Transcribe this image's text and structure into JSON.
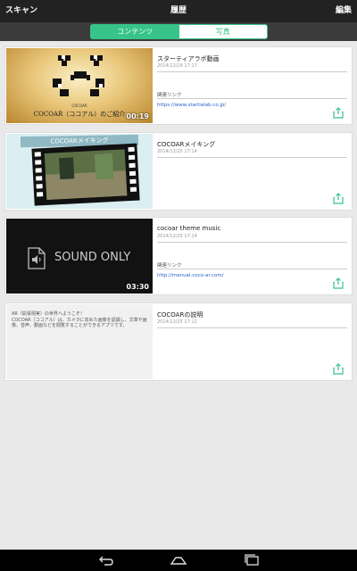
{
  "header": {
    "left_button": "スキャン",
    "title": "履歴",
    "right_button": "編集"
  },
  "tabs": [
    {
      "label": "コンテンツ",
      "active": true
    },
    {
      "label": "写真",
      "active": false
    }
  ],
  "cards": [
    {
      "title": "スターティアラボ動画",
      "date": "2014/12/29 17:17",
      "related_label": "関連リンク",
      "related_link": "https://www.startialab.co.jp/",
      "thumb_caption": "COCOAR（ココアル）のご紹介",
      "thumb_small": "COCOAR",
      "duration": "00:19"
    },
    {
      "title": "COCOARメイキング",
      "date": "2014/12/25 17:14",
      "thumb_banner": "COCOARメイキング"
    },
    {
      "title": "cocoar theme music",
      "date": "2014/12/25 17:14",
      "related_label": "関連リンク",
      "related_link": "http://manual.coco-ar.com/",
      "thumb_text": "SOUND ONLY",
      "duration": "03:30"
    },
    {
      "title": "COCOARの説明",
      "date": "2014/12/25 17:12",
      "thumb_text": "AR（拡張現実）の世界へようこそ！\nCOCOAR（ココアル）は、カメラに収めた画像を認識し、文章や画像、音声、動画などを閲覧することができるアプリです。"
    }
  ],
  "colors": {
    "accent": "#37c489",
    "link": "#2a62c9",
    "header_bg": "#222222"
  }
}
